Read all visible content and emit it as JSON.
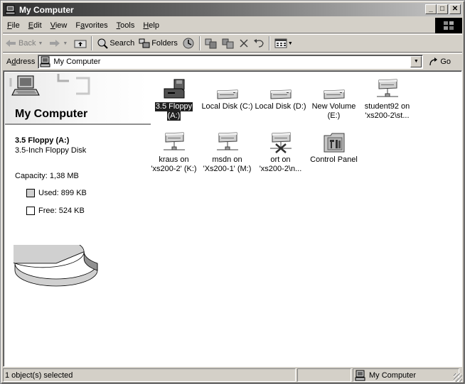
{
  "window": {
    "title": "My Computer",
    "controls": {
      "minimize": "_",
      "maximize": "□",
      "close": "✕"
    }
  },
  "menu": {
    "items": [
      {
        "label": "File",
        "accel": "F",
        "rest": "ile"
      },
      {
        "label": "Edit",
        "accel": "E",
        "rest": "dit"
      },
      {
        "label": "View",
        "accel": "V",
        "rest": "iew"
      },
      {
        "label": "Favorites",
        "pre": "F",
        "accel": "a",
        "rest": "vorites"
      },
      {
        "label": "Tools",
        "accel": "T",
        "rest": "ools"
      },
      {
        "label": "Help",
        "accel": "H",
        "rest": "elp"
      }
    ]
  },
  "toolbar": {
    "back_label": "Back",
    "search_label": "Search",
    "folders_label": "Folders"
  },
  "address": {
    "label_pre": "A",
    "label_accel": "d",
    "label_rest": "dress",
    "value": "My Computer",
    "go_label": "Go"
  },
  "left_pane": {
    "title": "My Computer",
    "drive_name": "3.5 Floppy (A:)",
    "drive_type": "3.5-Inch Floppy Disk",
    "capacity": "Capacity: 1,38 MB",
    "used": "Used: 899 KB",
    "free": "Free: 524 KB",
    "used_fraction": 0.632,
    "colors": {
      "used": "#d0d0d0",
      "free": "#ffffff"
    }
  },
  "icons": [
    {
      "line1": "3.5 Floppy",
      "line2": "(A:)",
      "type": "floppy",
      "selected": true
    },
    {
      "line1": "Local Disk (C:)",
      "line2": "",
      "type": "disk",
      "selected": false
    },
    {
      "line1": "Local Disk (D:)",
      "line2": "",
      "type": "disk",
      "selected": false
    },
    {
      "line1": "New Volume",
      "line2": "(E:)",
      "type": "disk",
      "selected": false
    },
    {
      "line1": "student92 on",
      "line2": "'xs200-2\\st...",
      "type": "network",
      "selected": false
    },
    {
      "line1": "kraus on",
      "line2": "'xs200-2' (K:)",
      "type": "network",
      "selected": false
    },
    {
      "line1": "msdn on",
      "line2": "'Xs200-1' (M:)",
      "type": "network",
      "selected": false
    },
    {
      "line1": "ort on",
      "line2": "'xs200-2\\n...",
      "type": "network-disconnected",
      "selected": false
    },
    {
      "line1": "Control Panel",
      "line2": "",
      "type": "control-panel",
      "selected": false
    }
  ],
  "statusbar": {
    "selection": "1 object(s) selected",
    "middle": "",
    "zone": "My Computer"
  }
}
